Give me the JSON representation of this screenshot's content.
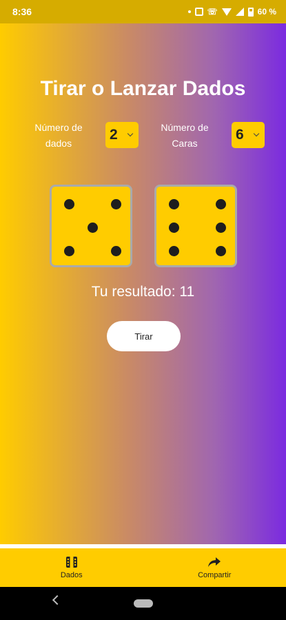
{
  "status_bar": {
    "time": "8:36",
    "battery": "60 %"
  },
  "title": "Tirar o Lanzar Dados",
  "controls": {
    "dice_count_label": "Número de dados",
    "dice_count_value": "2",
    "faces_label": "Número de Caras",
    "faces_value": "6"
  },
  "dice": [
    5,
    6
  ],
  "result": {
    "label": "Tu resultado: 11"
  },
  "roll_button": "Tirar",
  "bottom_nav": {
    "items": [
      {
        "label": "Dados",
        "icon": "dice-icon"
      },
      {
        "label": "Compartir",
        "icon": "share-arrow-icon"
      }
    ]
  },
  "colors": {
    "accent": "#ffcc00",
    "gradient_end": "#7b2be0"
  }
}
